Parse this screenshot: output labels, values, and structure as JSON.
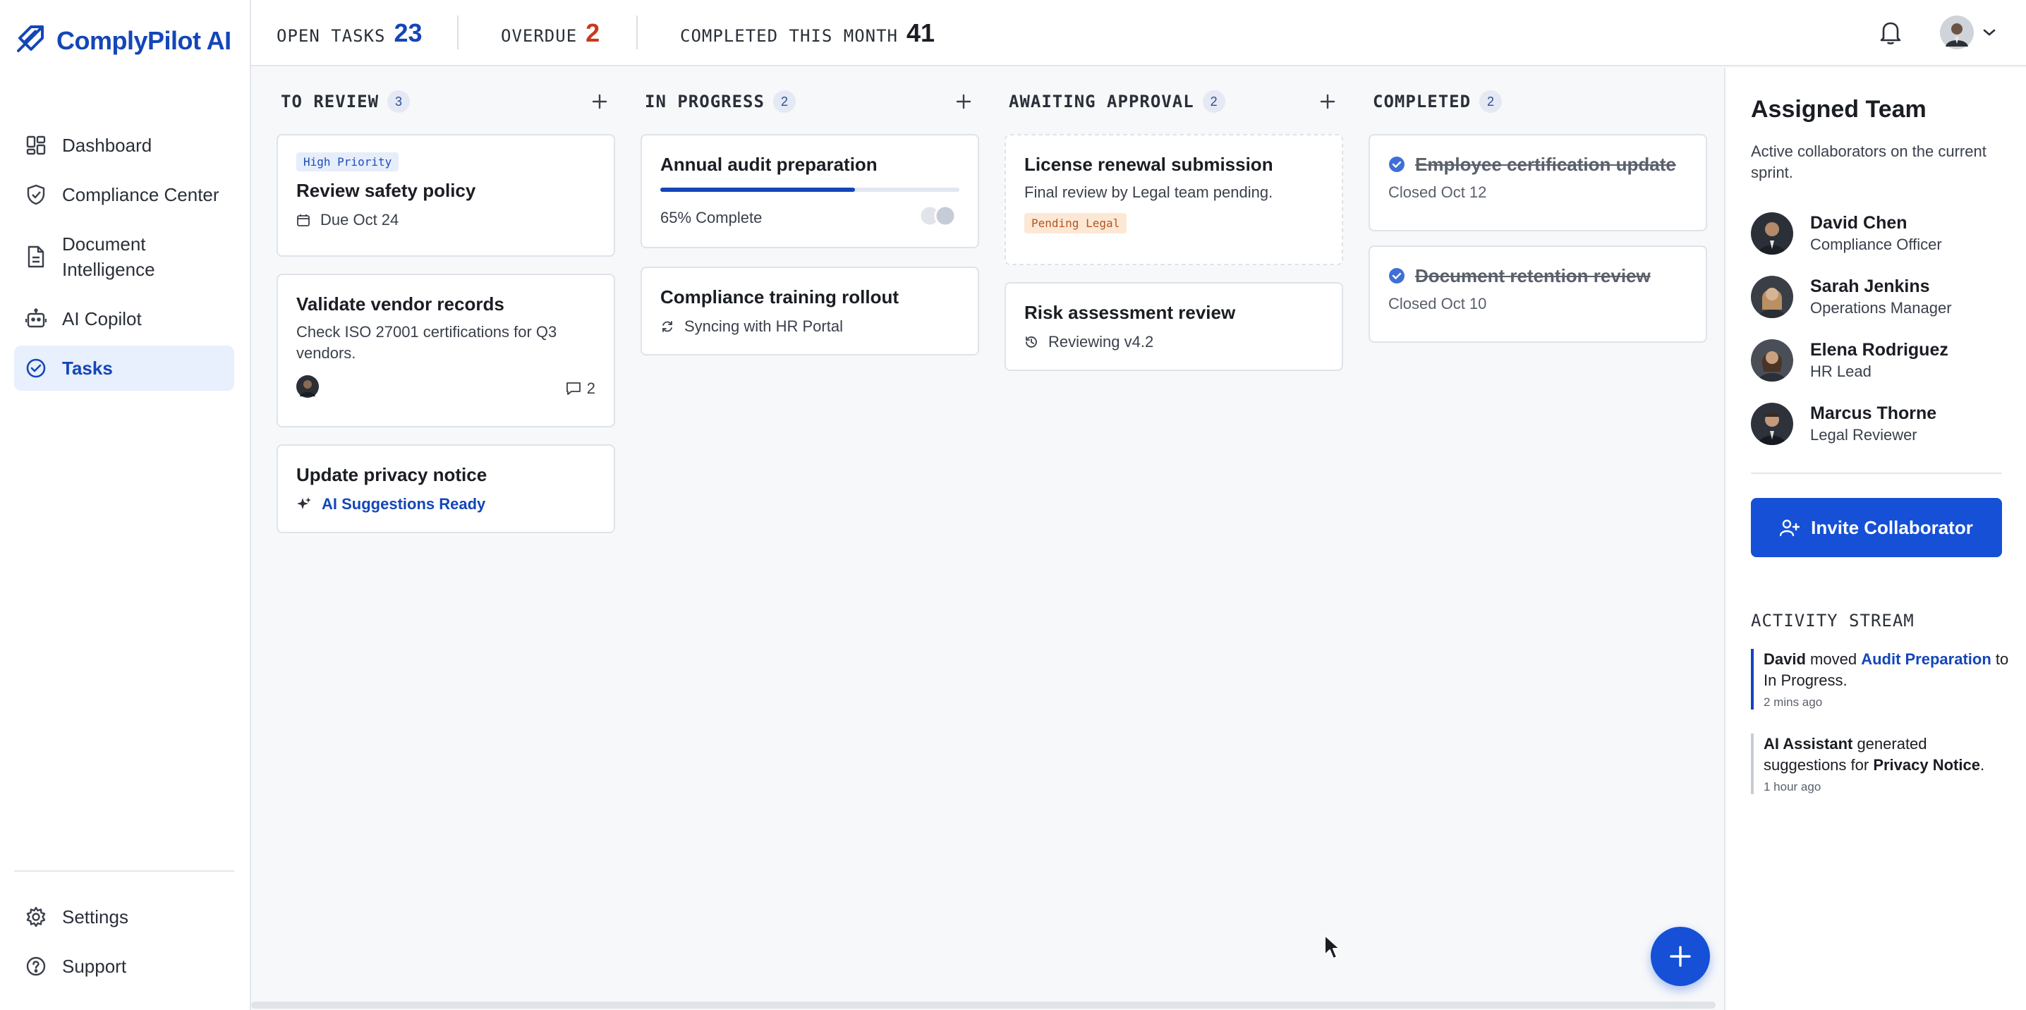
{
  "app": {
    "name": "ComplyPilot AI",
    "accent": "#1446b8"
  },
  "sidebar": {
    "items": [
      {
        "label": "Dashboard",
        "icon": "grid-icon"
      },
      {
        "label": "Compliance Center",
        "icon": "shield-check-icon"
      },
      {
        "label": "Document Intelligence",
        "icon": "document-icon"
      },
      {
        "label": "AI Copilot",
        "icon": "robot-icon"
      },
      {
        "label": "Tasks",
        "icon": "check-circle-icon",
        "active": true
      }
    ],
    "bottom": [
      {
        "label": "Settings",
        "icon": "gear-icon"
      },
      {
        "label": "Support",
        "icon": "help-circle-icon"
      }
    ]
  },
  "topbar": {
    "open_label": "OPEN TASKS",
    "open_value": "23",
    "overdue_label": "OVERDUE",
    "overdue_value": "2",
    "completed_label": "COMPLETED THIS MONTH",
    "completed_value": "41",
    "colors": {
      "open": "#1446b8",
      "overdue": "#c8391c",
      "completed": "#1a1d23"
    }
  },
  "board": {
    "columns": [
      {
        "title": "TO REVIEW",
        "count": "3",
        "cards": [
          {
            "badge": "High Priority",
            "title": "Review safety policy",
            "due": "Due Oct 24"
          },
          {
            "title": "Validate vendor records",
            "desc": "Check ISO 27001 certifications for Q3 vendors.",
            "comments": "2"
          },
          {
            "title": "Update privacy notice",
            "ai": "AI Suggestions Ready"
          }
        ]
      },
      {
        "title": "IN PROGRESS",
        "count": "2",
        "cards": [
          {
            "title": "Annual audit preparation",
            "progress": 0.65,
            "progress_label": "65% Complete"
          },
          {
            "title": "Compliance training rollout",
            "status": "Syncing with HR Portal"
          }
        ]
      },
      {
        "title": "AWAITING APPROVAL",
        "count": "2",
        "cards": [
          {
            "title": "License renewal submission",
            "desc": "Final review by Legal team pending.",
            "badge": "Pending Legal"
          },
          {
            "title": "Risk assessment review",
            "status": "Reviewing v4.2"
          }
        ]
      },
      {
        "title": "COMPLETED",
        "count": "2",
        "cards": [
          {
            "title": "Employee certification update",
            "closed": "Closed Oct 12"
          },
          {
            "title": "Document retention review",
            "closed": "Closed Oct 10"
          }
        ]
      }
    ]
  },
  "panel": {
    "title": "Assigned Team",
    "desc": "Active collaborators on the current sprint.",
    "members": [
      {
        "name": "David Chen",
        "role": "Compliance Officer"
      },
      {
        "name": "Sarah Jenkins",
        "role": "Operations Manager"
      },
      {
        "name": "Elena Rodriguez",
        "role": "HR Lead"
      },
      {
        "name": "Marcus Thorne",
        "role": "Legal Reviewer"
      }
    ],
    "invite_label": "Invite Collaborator",
    "activity_title": "ACTIVITY STREAM",
    "activity": [
      {
        "actor": "David",
        "verb": " moved ",
        "target": "Audit Preparation",
        "rest": " to In Progress.",
        "time": "2 mins ago"
      },
      {
        "actor": "AI Assistant",
        "verb": " generated suggestions for ",
        "target": "Privacy Notice",
        "rest": ".",
        "time": "1 hour ago"
      }
    ]
  }
}
